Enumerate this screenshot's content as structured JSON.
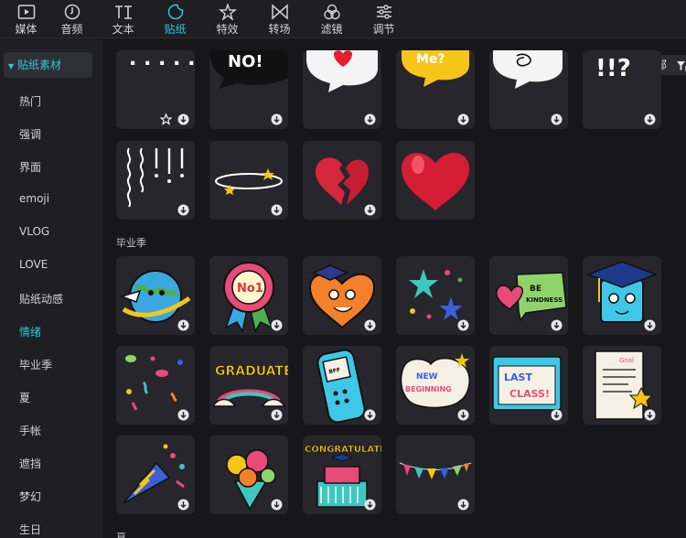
{
  "toolbar": {
    "tabs": [
      {
        "label": "媒体",
        "icon": "media-icon"
      },
      {
        "label": "音频",
        "icon": "audio-icon"
      },
      {
        "label": "文本",
        "icon": "text-icon"
      },
      {
        "label": "贴纸",
        "icon": "sticker-icon",
        "active": true
      },
      {
        "label": "特效",
        "icon": "effects-icon"
      },
      {
        "label": "转场",
        "icon": "transition-icon"
      },
      {
        "label": "滤镜",
        "icon": "filter-icon"
      },
      {
        "label": "调节",
        "icon": "adjust-icon"
      }
    ]
  },
  "sidebar": {
    "header": "贴纸素材",
    "items": [
      "热门",
      "强调",
      "界面",
      "emoji",
      "VLOG",
      "LOVE",
      "贴纸动感",
      "情绪",
      "毕业季",
      "夏",
      "手帐",
      "遮挡",
      "梦幻",
      "生日"
    ],
    "active_index": 7
  },
  "filter": {
    "label": "全部"
  },
  "sections": [
    {
      "title": "毕业季"
    },
    {
      "title": "夏"
    }
  ],
  "colors": {
    "accent": "#2ec8d6",
    "background": "#17171b",
    "tile": "#26262c"
  }
}
